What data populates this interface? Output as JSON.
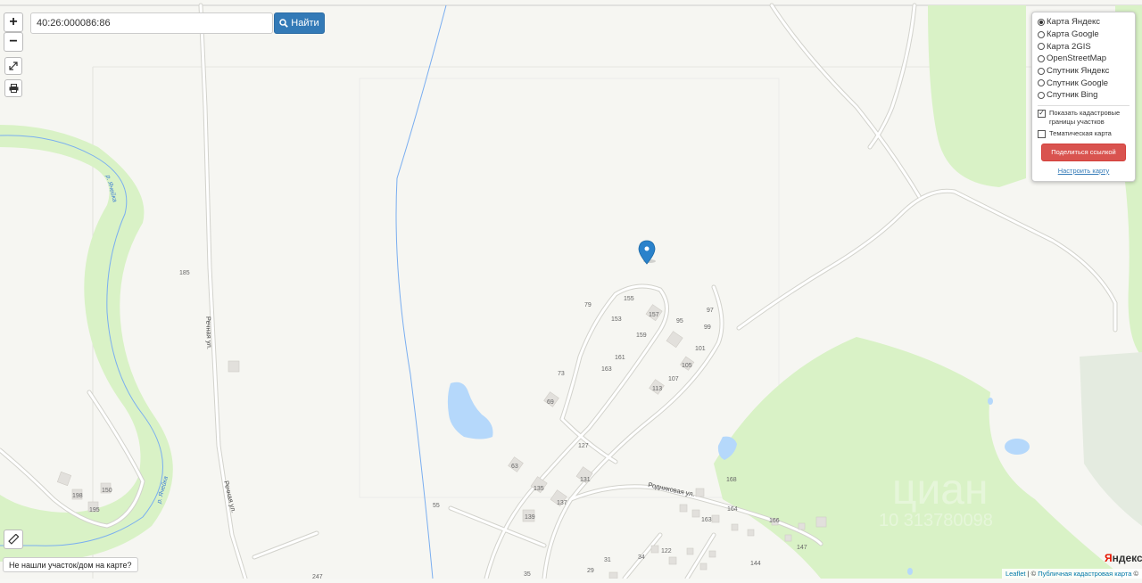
{
  "search": {
    "value": "40:26:000086:86",
    "button_label": "Найти"
  },
  "controls": {
    "zoom_in": "+",
    "zoom_out": "−"
  },
  "layers": {
    "options": [
      "Карта Яндекс",
      "Карта Google",
      "Карта 2GIS",
      "OpenStreetMap",
      "Спутник Яндекс",
      "Спутник Google",
      "Спутник Bing"
    ],
    "selected": "Карта Яндекс",
    "checkboxes": [
      {
        "label": "Показать кадастровые границы участков",
        "checked": true
      },
      {
        "label": "Тематическая карта",
        "checked": false
      }
    ],
    "share_button": "Поделиться ссылкой",
    "settings_link": "Настроить карту"
  },
  "not_found_button": "Не нашли участок/дом на карте?",
  "attribution": {
    "leaflet": "Leaflet",
    "sep": " | © ",
    "pkk": "Публичная кадастровая карта",
    "tail": " ©"
  },
  "yandex_logo": {
    "first": "Я",
    "rest": "ндекс"
  },
  "map": {
    "streets": [
      "Речная ул.",
      "Речная ул.",
      "Родниковая ул."
    ],
    "river_labels": [
      "р. Ячейка",
      "р. Ячейка"
    ],
    "house_numbers": [
      "185",
      "198",
      "150",
      "195",
      "79",
      "155",
      "153",
      "157",
      "95",
      "97",
      "99",
      "159",
      "161",
      "101",
      "73",
      "163",
      "105",
      "107",
      "113",
      "69",
      "127",
      "63",
      "131",
      "135",
      "137",
      "139",
      "55",
      "168",
      "164",
      "166",
      "163",
      "147",
      "122",
      "144",
      "31",
      "34",
      "29",
      "35",
      "247"
    ],
    "watermark": {
      "brand": "циан",
      "phone": "10 313780098"
    }
  },
  "colors": {
    "forest": "#d9f2c6",
    "water": "#b5d8fb",
    "road": "#ffffff",
    "accent": "#337ab7",
    "danger": "#d9534f"
  }
}
